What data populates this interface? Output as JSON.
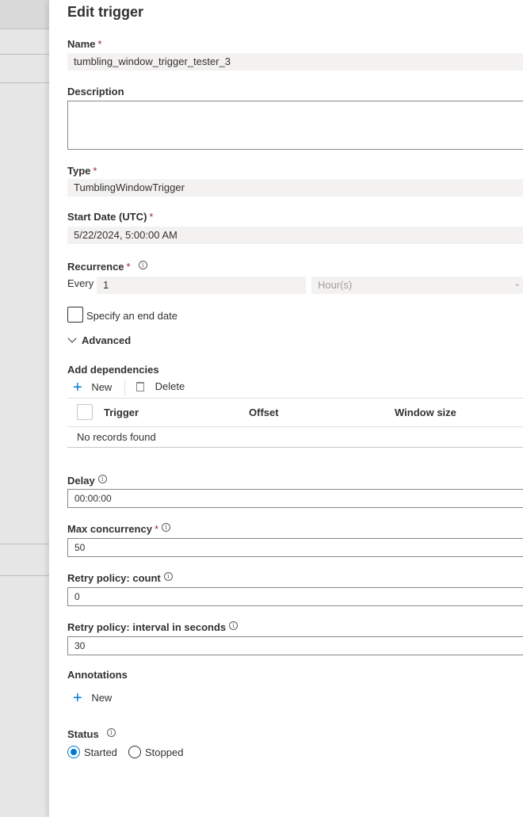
{
  "panel": {
    "title": "Edit trigger"
  },
  "name": {
    "label": "Name",
    "value": "tumbling_window_trigger_tester_3"
  },
  "description": {
    "label": "Description",
    "value": ""
  },
  "type": {
    "label": "Type",
    "value": "TumblingWindowTrigger"
  },
  "start_date": {
    "label": "Start Date (UTC)",
    "value": "5/22/2024, 5:00:00 AM"
  },
  "recurrence": {
    "label": "Recurrence",
    "every_label": "Every",
    "interval": "1",
    "unit": "Hour(s)"
  },
  "end_date": {
    "label": "Specify an end date",
    "checked": false
  },
  "advanced": {
    "label": "Advanced",
    "expanded": true
  },
  "dependencies": {
    "label": "Add dependencies",
    "new_label": "New",
    "delete_label": "Delete",
    "columns": [
      "Trigger",
      "Offset",
      "Window size"
    ],
    "empty_text": "No records found"
  },
  "delay": {
    "label": "Delay",
    "value": "00:00:00"
  },
  "max_concurrency": {
    "label": "Max concurrency",
    "value": "50"
  },
  "retry_count": {
    "label": "Retry policy: count",
    "value": "0"
  },
  "retry_interval": {
    "label": "Retry policy: interval in seconds",
    "value": "30"
  },
  "annotations": {
    "label": "Annotations",
    "new_label": "New"
  },
  "status": {
    "label": "Status",
    "options": [
      "Started",
      "Stopped"
    ],
    "selected": "Started"
  },
  "colors": {
    "accent": "#0078d4",
    "required": "#a4262c",
    "readonly_bg": "#f3f2f1"
  }
}
